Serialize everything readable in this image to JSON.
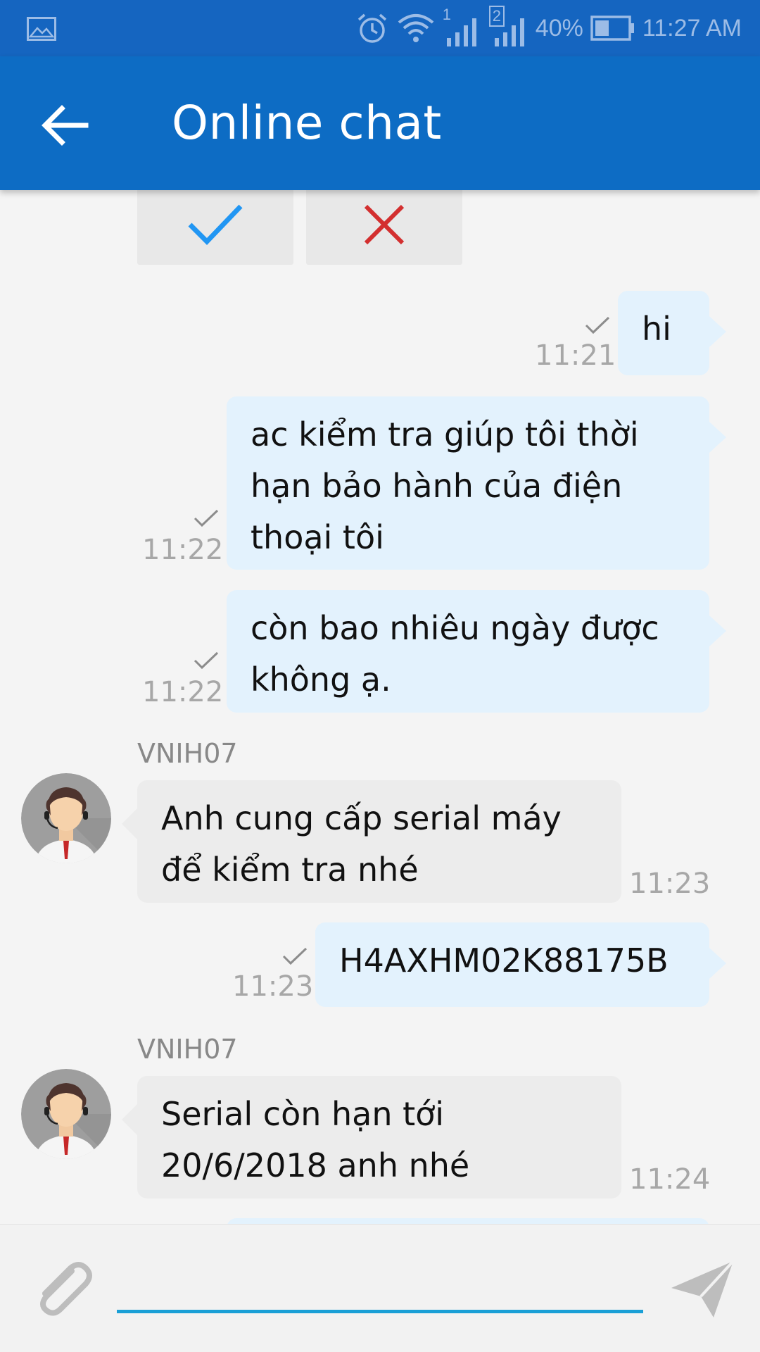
{
  "status_bar": {
    "sim1": "1",
    "sim2": "2",
    "battery": "40%",
    "time": "11:27 AM",
    "icons": [
      "gallery-icon",
      "alarm-icon",
      "wifi-icon",
      "signal-icon",
      "battery-icon"
    ]
  },
  "toolbar": {
    "title": "Online chat",
    "back_icon": "arrow-left-icon"
  },
  "choice_buttons": {
    "confirm_icon": "check-icon",
    "cancel_icon": "close-icon"
  },
  "messages": [
    {
      "from": "me",
      "lines": [
        "hi"
      ],
      "time": "11:21"
    },
    {
      "from": "me",
      "lines": [
        "ac kiểm tra giúp tôi thời",
        "hạn bảo hành của điện",
        "thoại tôi"
      ],
      "time": "11:22"
    },
    {
      "from": "me",
      "lines": [
        "còn bao nhiêu ngày được",
        "không ạ."
      ],
      "time": "11:22"
    },
    {
      "from": "agent",
      "sender": "VNIH07",
      "lines": [
        "Anh cung cấp serial máy",
        "để kiểm tra nhé"
      ],
      "time": "11:23"
    },
    {
      "from": "me",
      "lines": [
        "H4AXHM02K88175B"
      ],
      "time": "11:23"
    },
    {
      "from": "agent",
      "sender": "VNIH07",
      "lines": [
        "Serial còn hạn tới",
        "20/6/2018 anh nhé"
      ],
      "time": "11:24"
    }
  ],
  "input": {
    "value": "",
    "placeholder": "",
    "attach_icon": "paperclip-icon",
    "send_icon": "send-icon"
  },
  "colors": {
    "status_bar": "#1565c0",
    "toolbar": "#0d6cc4",
    "my_bubble": "#e3f2fd",
    "agent_bubble": "#ececec",
    "input_underline": "#1a9fd6",
    "check": "#2196f3",
    "cross": "#d32f2f"
  }
}
